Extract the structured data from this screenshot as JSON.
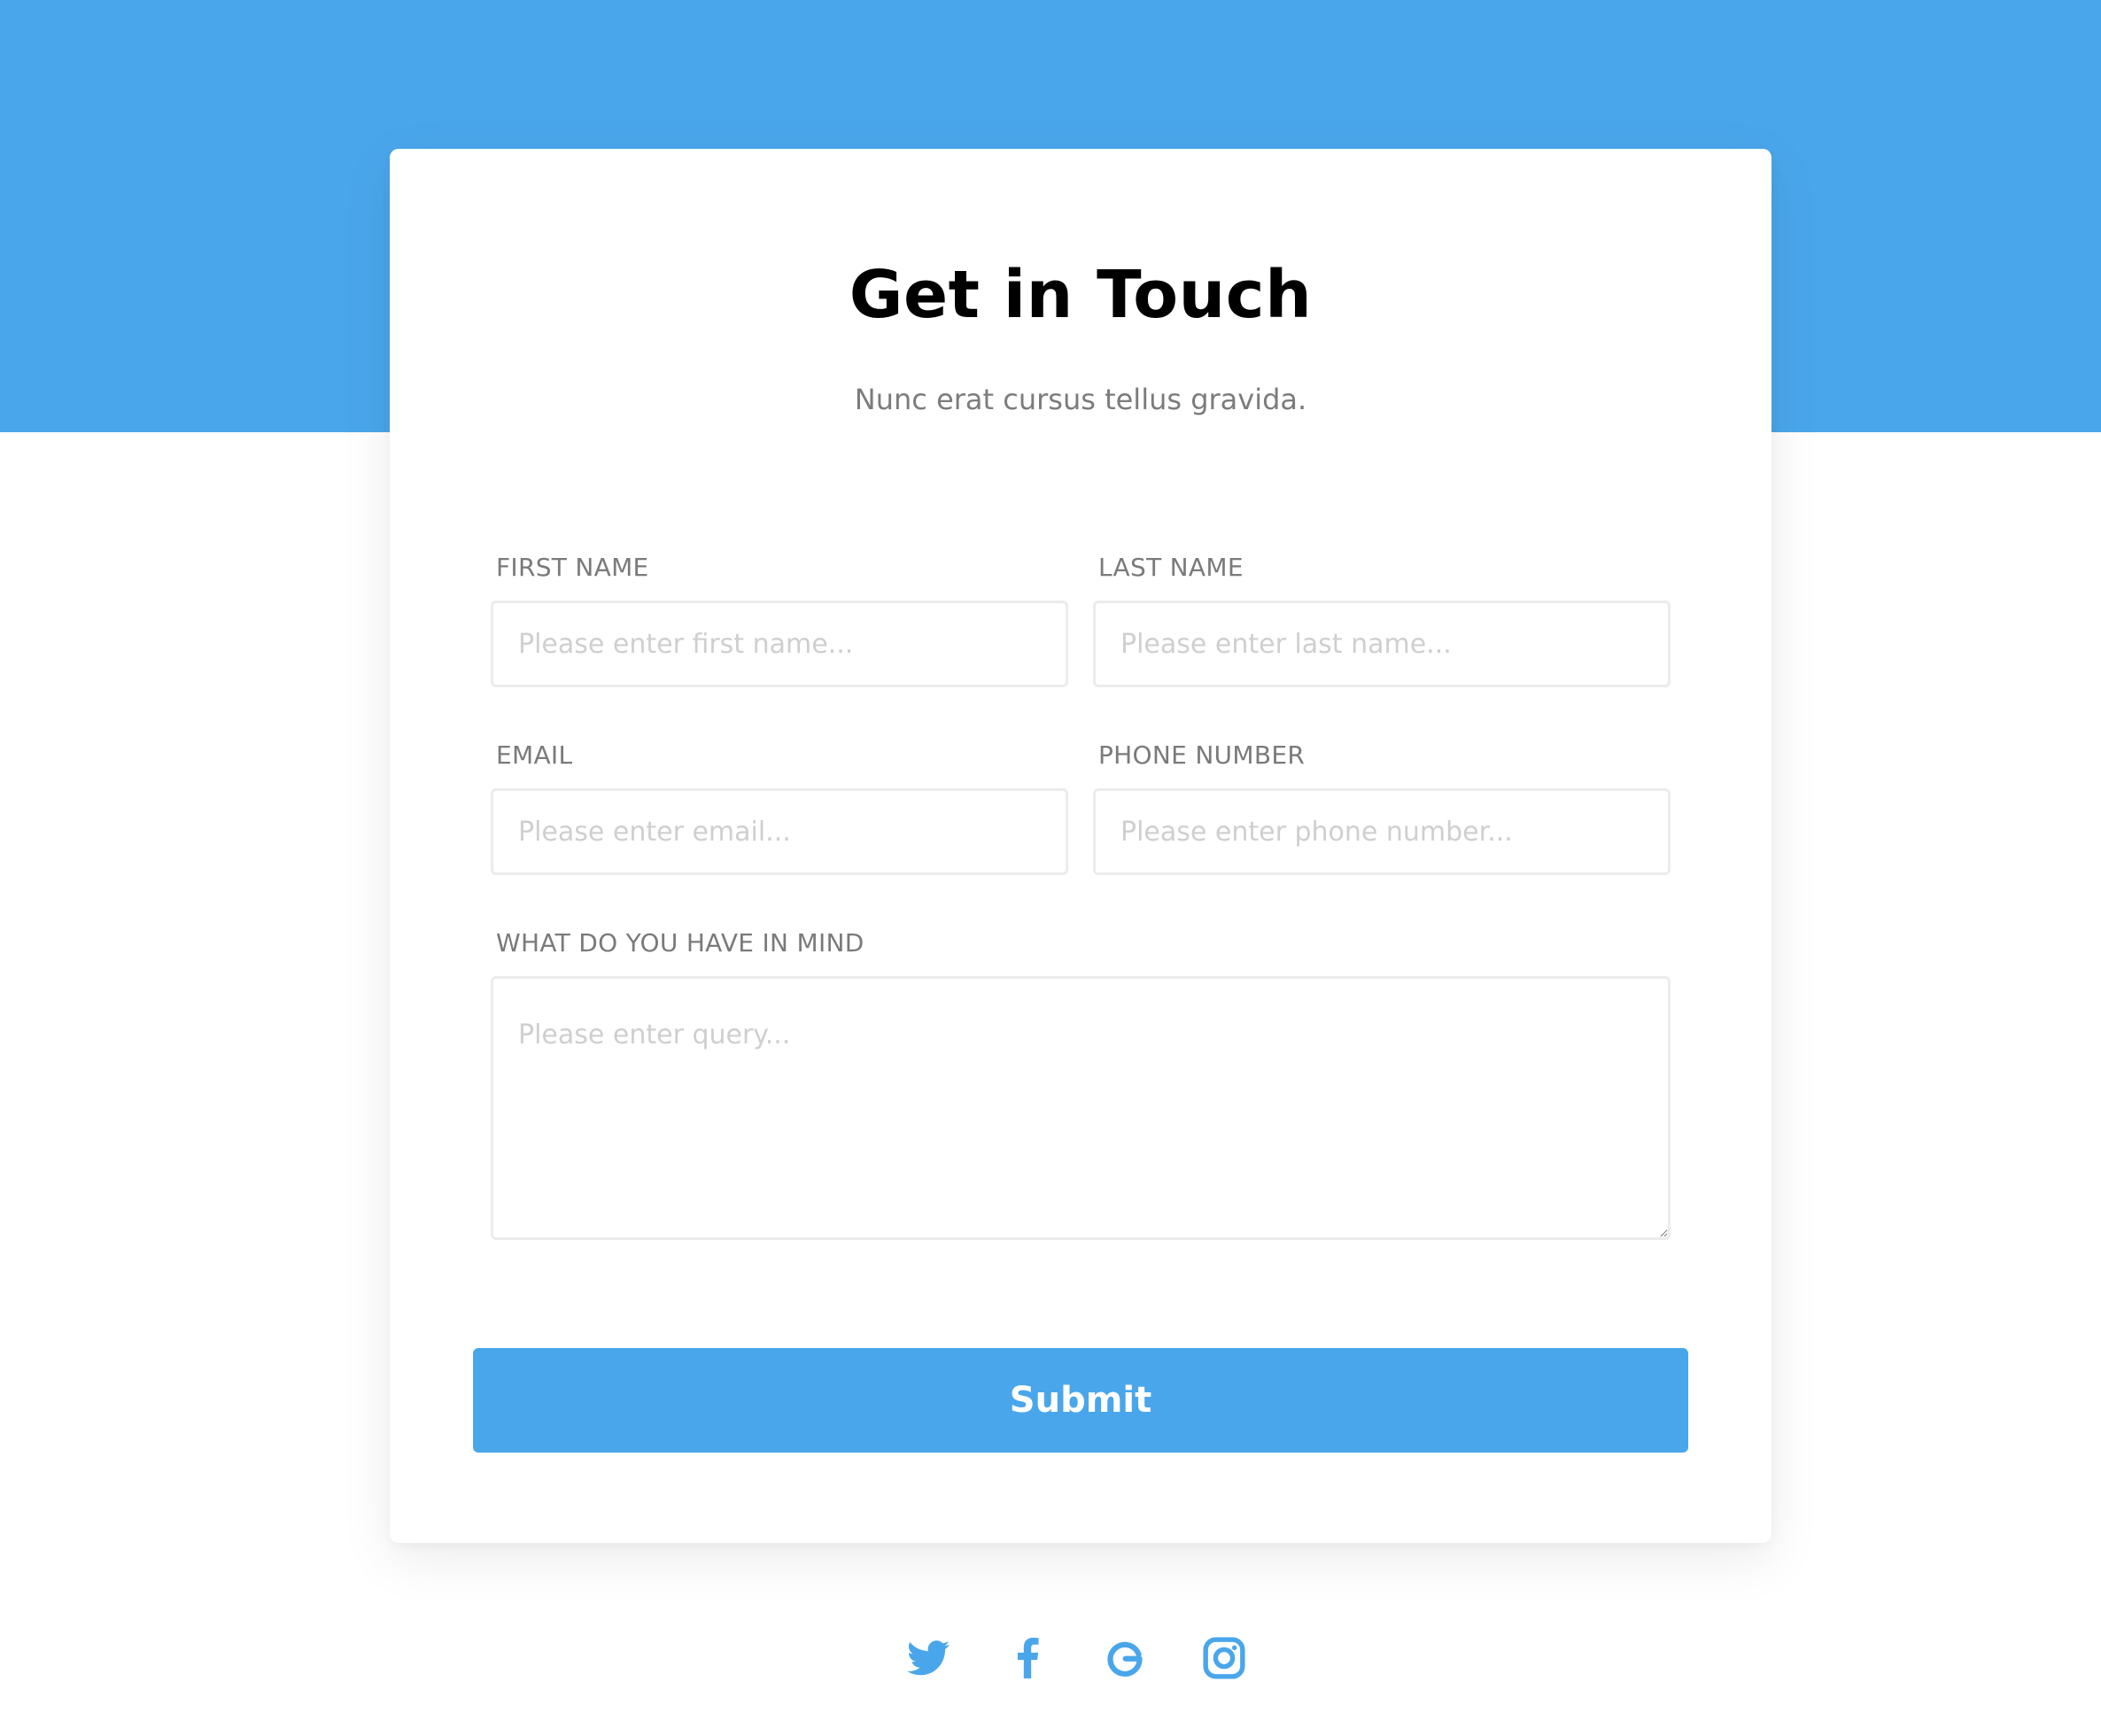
{
  "colors": {
    "accent": "#4aa6eb",
    "title": "#000000",
    "subtitle": "#7c7c7c",
    "label": "#7a7a7a",
    "placeholder": "#cfcfcf",
    "input_border": "#ececec"
  },
  "form": {
    "title": "Get in Touch",
    "subtitle": "Nunc erat cursus tellus gravida.",
    "fields": {
      "first_name": {
        "label": "FIRST NAME",
        "placeholder": "Please enter first name...",
        "value": ""
      },
      "last_name": {
        "label": "LAST NAME",
        "placeholder": "Please enter last name...",
        "value": ""
      },
      "email": {
        "label": "EMAIL",
        "placeholder": "Please enter email...",
        "value": ""
      },
      "phone": {
        "label": "PHONE NUMBER",
        "placeholder": "Please enter phone number...",
        "value": ""
      },
      "query": {
        "label": "WHAT DO YOU HAVE IN MIND",
        "placeholder": "Please enter query...",
        "value": ""
      }
    },
    "submit_label": "Submit"
  },
  "social": {
    "icons": [
      "twitter-icon",
      "facebook-icon",
      "google-icon",
      "instagram-icon"
    ]
  }
}
